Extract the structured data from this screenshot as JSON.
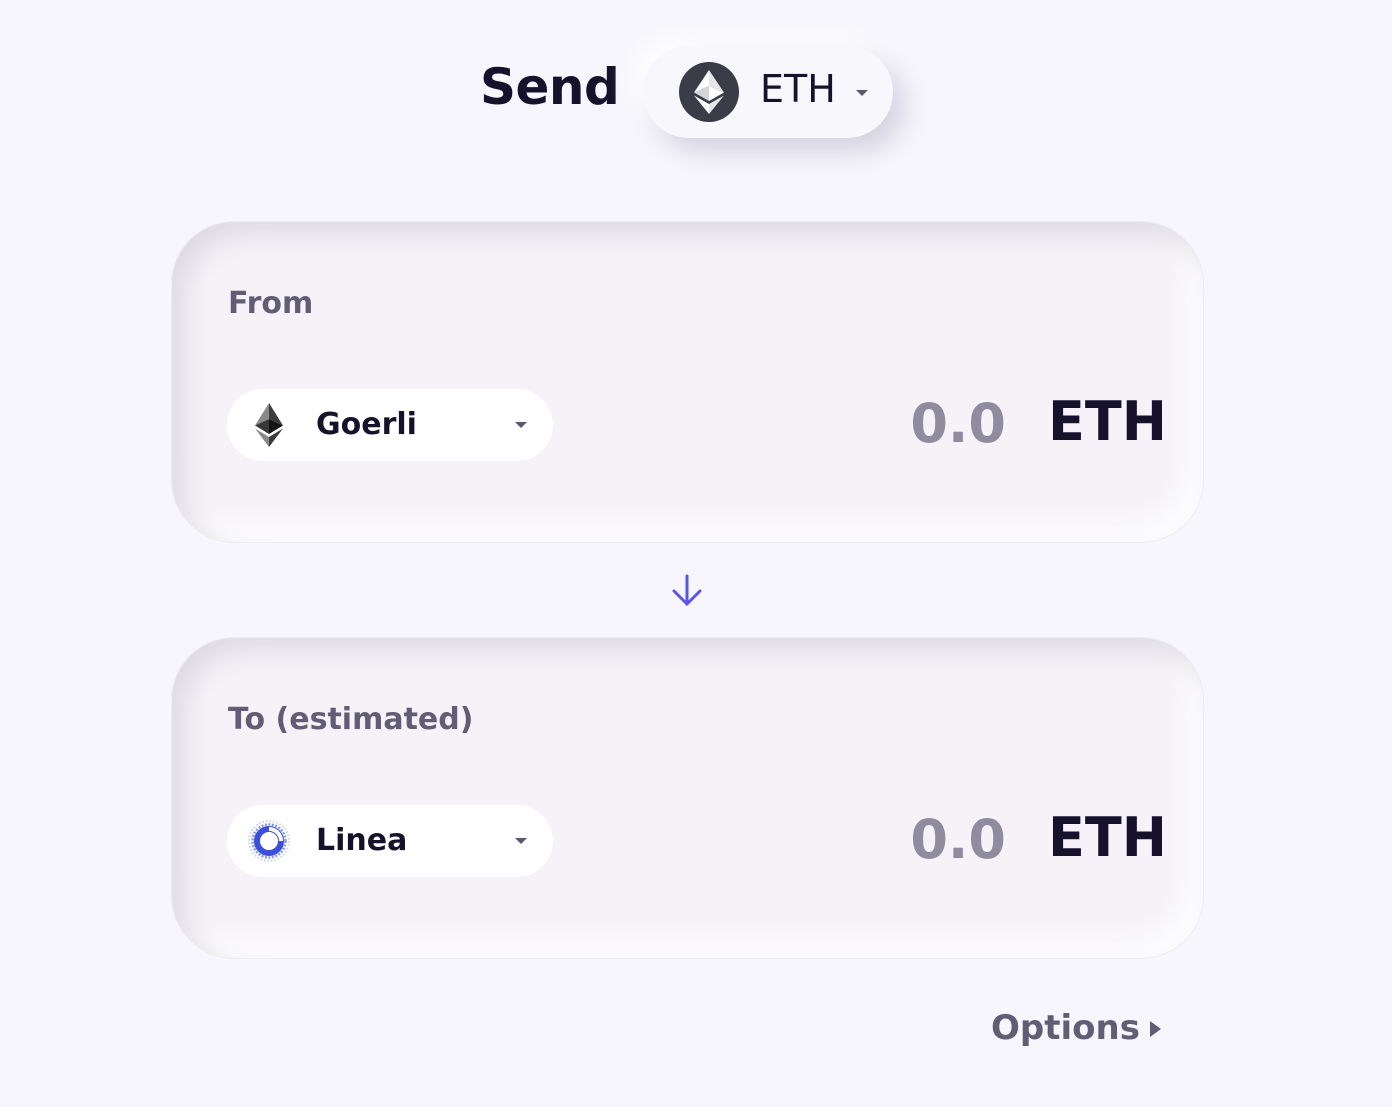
{
  "header": {
    "title": "Send",
    "token": {
      "symbol": "ETH",
      "icon": "ethereum-icon"
    }
  },
  "from_card": {
    "label": "From",
    "network": {
      "name": "Goerli",
      "icon": "ethereum-icon"
    },
    "amount_placeholder": "0.0",
    "unit": "ETH"
  },
  "direction_icon": "arrow-down-icon",
  "to_card": {
    "label": "To (estimated)",
    "network": {
      "name": "Linea",
      "icon": "linea-icon"
    },
    "amount_placeholder": "0.0",
    "unit": "ETH"
  },
  "options": {
    "label": "Options",
    "icon": "triangle-right-icon"
  },
  "colors": {
    "background": "#f7f6fc",
    "text_primary": "#16122c",
    "text_secondary": "#615d75",
    "placeholder": "#8f8ca0",
    "accent": "#5b55e6",
    "linea_blue": "#3b4fd8"
  }
}
